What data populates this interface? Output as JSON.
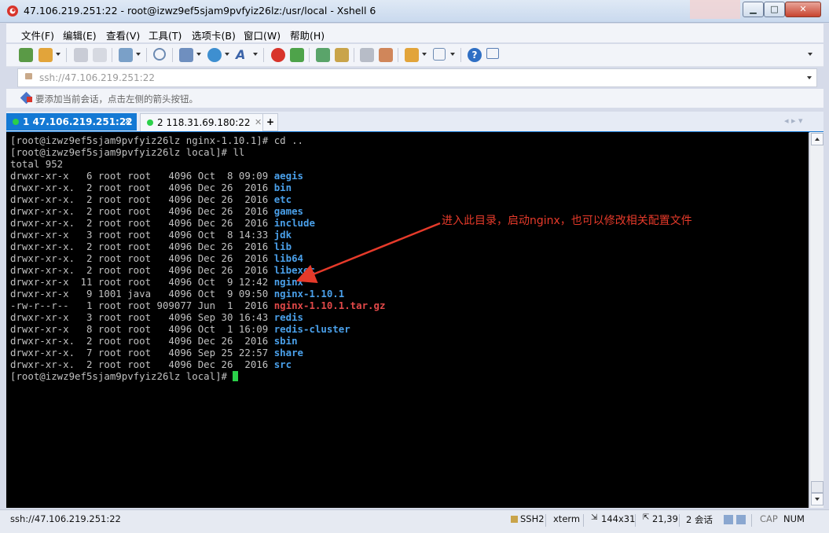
{
  "window": {
    "title": "47.106.219.251:22 - root@izwz9ef5sjam9pvfyiz26lz:/usr/local - Xshell 6",
    "min_label": "▁",
    "max_label": "□",
    "close_label": "✕"
  },
  "menu": [
    "文件(F)",
    "编辑(E)",
    "查看(V)",
    "工具(T)",
    "选项卡(B)",
    "窗口(W)",
    "帮助(H)"
  ],
  "toolbar_icons": [
    "new-session-icon",
    "open-folder-icon",
    "reconnect-icon",
    "disconnect-icon",
    "properties-icon",
    "find-icon",
    "transfer-icon",
    "globe-icon",
    "font-icon",
    "xftp-icon",
    "xmanager-icon",
    "fullscreen-icon",
    "lock-icon",
    "keyboard-icon",
    "highlight-icon",
    "compose-icon",
    "layout-icon",
    "help-icon",
    "chat-icon"
  ],
  "address": {
    "value": "ssh://47.106.219.251:22"
  },
  "hint": {
    "text": "要添加当前会话，点击左侧的箭头按钮。"
  },
  "tabs": [
    {
      "label": "1 47.106.219.251:22",
      "close": "✕"
    },
    {
      "label": "2 118.31.69.180:22",
      "close": "✕"
    }
  ],
  "tab_add": "+",
  "tab_nav": "◂  ▸   ▾",
  "terminal": {
    "lines": [
      {
        "text": "[root@izwz9ef5sjam9pvfyiz26lz nginx-1.10.1]# cd ..",
        "name": ""
      },
      {
        "text": "[root@izwz9ef5sjam9pvfyiz26lz local]# ll",
        "name": ""
      },
      {
        "text": "total 952",
        "name": ""
      },
      {
        "text": "drwxr-xr-x   6 root root   4096 Oct  8 09:09 ",
        "name": "aegis",
        "kind": "dir"
      },
      {
        "text": "drwxr-xr-x.  2 root root   4096 Dec 26  2016 ",
        "name": "bin",
        "kind": "dir"
      },
      {
        "text": "drwxr-xr-x.  2 root root   4096 Dec 26  2016 ",
        "name": "etc",
        "kind": "dir"
      },
      {
        "text": "drwxr-xr-x.  2 root root   4096 Dec 26  2016 ",
        "name": "games",
        "kind": "dir"
      },
      {
        "text": "drwxr-xr-x.  2 root root   4096 Dec 26  2016 ",
        "name": "include",
        "kind": "dir"
      },
      {
        "text": "drwxr-xr-x   3 root root   4096 Oct  8 14:33 ",
        "name": "jdk",
        "kind": "dir"
      },
      {
        "text": "drwxr-xr-x.  2 root root   4096 Dec 26  2016 ",
        "name": "lib",
        "kind": "dir"
      },
      {
        "text": "drwxr-xr-x.  2 root root   4096 Dec 26  2016 ",
        "name": "lib64",
        "kind": "dir"
      },
      {
        "text": "drwxr-xr-x.  2 root root   4096 Dec 26  2016 ",
        "name": "libexec",
        "kind": "dir"
      },
      {
        "text": "drwxr-xr-x  11 root root   4096 Oct  9 12:42 ",
        "name": "nginx",
        "kind": "dir"
      },
      {
        "text": "drwxr-xr-x   9 1001 java   4096 Oct  9 09:50 ",
        "name": "nginx-1.10.1",
        "kind": "dir"
      },
      {
        "text": "-rw-r--r--   1 root root 909077 Jun  1  2016 ",
        "name": "nginx-1.10.1.tar.gz",
        "kind": "arc"
      },
      {
        "text": "drwxr-xr-x   3 root root   4096 Sep 30 16:43 ",
        "name": "redis",
        "kind": "dir"
      },
      {
        "text": "drwxr-xr-x   8 root root   4096 Oct  1 16:09 ",
        "name": "redis-cluster",
        "kind": "dir"
      },
      {
        "text": "drwxr-xr-x.  2 root root   4096 Dec 26  2016 ",
        "name": "sbin",
        "kind": "dir"
      },
      {
        "text": "drwxr-xr-x.  7 root root   4096 Sep 25 22:57 ",
        "name": "share",
        "kind": "dir"
      },
      {
        "text": "drwxr-xr-x.  2 root root   4096 Dec 26  2016 ",
        "name": "src",
        "kind": "dir"
      },
      {
        "text": "[root@izwz9ef5sjam9pvfyiz26lz local]# ",
        "name": "",
        "cursor": true
      }
    ],
    "annotation": "进入此目录，启动nginx，也可以修改相关配置文件",
    "colors": {
      "dir": "#4aa0ea",
      "archive": "#e04848",
      "text": "#c0c0c0",
      "cursor": "#2bd04a",
      "annotation": "#e63a2a"
    }
  },
  "status": {
    "connection": "ssh://47.106.219.251:22",
    "protocol": "SSH2",
    "term": "xterm",
    "size": "144x31",
    "cursor_pos": "21,39",
    "sessions": "2 会话",
    "caps": "CAP",
    "num": "NUM"
  },
  "accent": "#1479d4"
}
